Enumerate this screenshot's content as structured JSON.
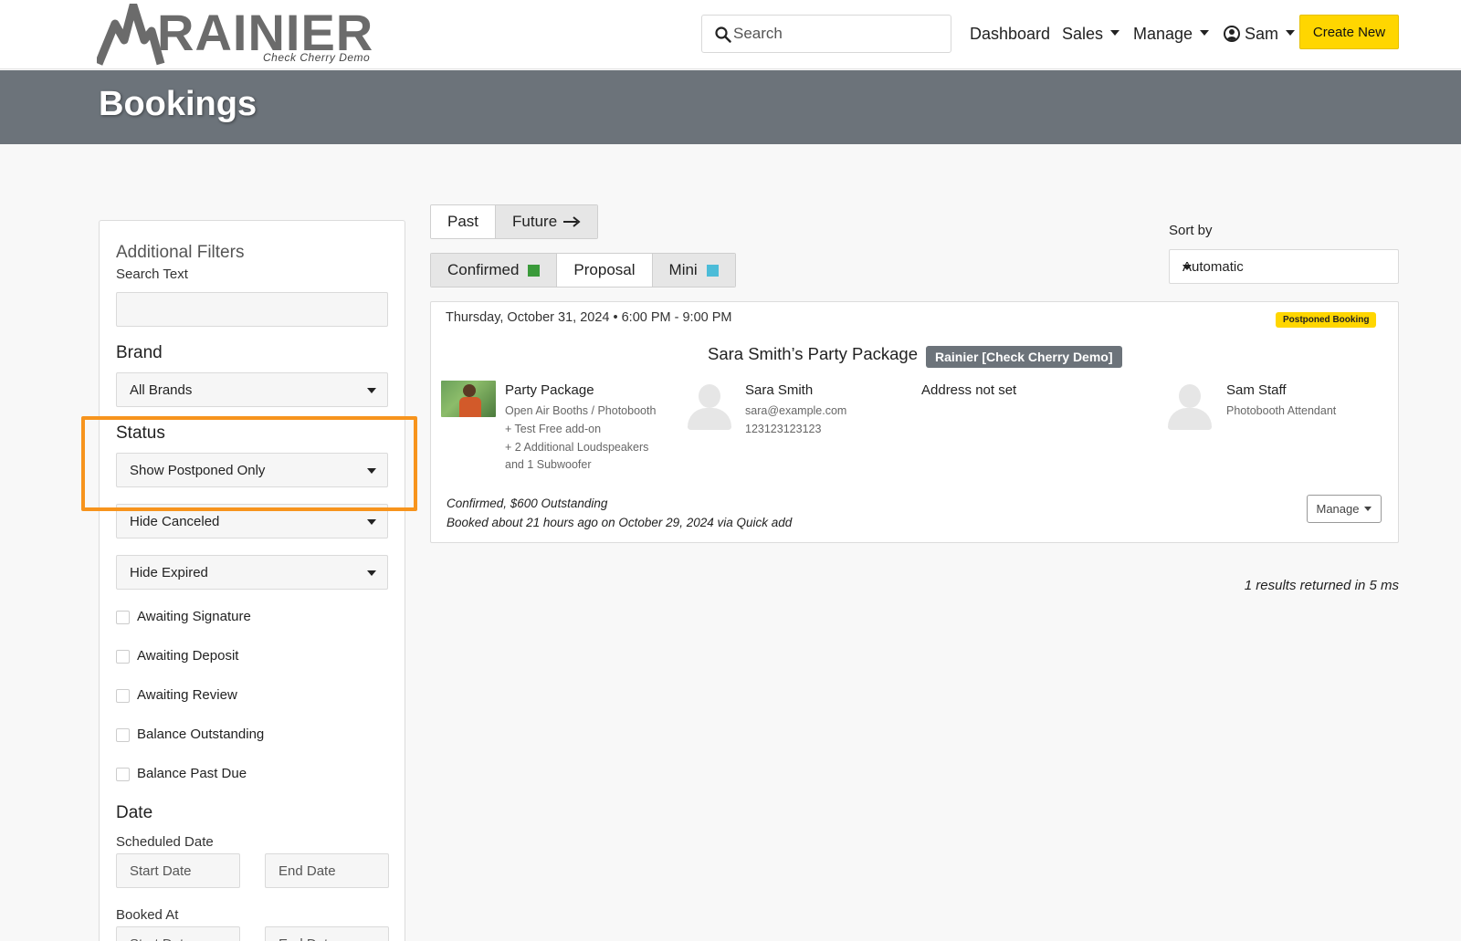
{
  "header": {
    "logo_text": "RAINIER",
    "logo_subtitle": "Check Cherry Demo",
    "search_placeholder": "Search",
    "nav": {
      "dashboard": "Dashboard",
      "sales": "Sales",
      "manage": "Manage",
      "user": "Sam"
    },
    "create_button": "Create New"
  },
  "page_title": "Bookings",
  "filters": {
    "title": "Additional Filters",
    "search_text_label": "Search Text",
    "search_text_value": "",
    "brand_label": "Brand",
    "brand_value": "All Brands",
    "status_label": "Status",
    "status_value": "Show Postponed Only",
    "canceled_value": "Hide Canceled",
    "expired_value": "Hide Expired",
    "checkboxes": [
      {
        "label": "Awaiting Signature",
        "checked": false
      },
      {
        "label": "Awaiting Deposit",
        "checked": false
      },
      {
        "label": "Awaiting Review",
        "checked": false
      },
      {
        "label": "Balance Outstanding",
        "checked": false
      },
      {
        "label": "Balance Past Due",
        "checked": false
      }
    ],
    "date_heading": "Date",
    "scheduled_label": "Scheduled Date",
    "booked_at_label": "Booked At",
    "start_placeholder": "Start Date",
    "end_placeholder": "End Date"
  },
  "time_tabs": {
    "past": "Past",
    "future": "Future",
    "active": "future"
  },
  "type_tabs": {
    "confirmed": "Confirmed",
    "proposal": "Proposal",
    "mini": "Mini",
    "confirmed_color": "#3a9a3a",
    "mini_color": "#4cbcd8"
  },
  "sort": {
    "label": "Sort by",
    "value": "Automatic"
  },
  "booking": {
    "datetime": "Thursday, October 31, 2024 • 6:00 PM - 9:00 PM",
    "status_badge": "Postponed Booking",
    "title": "Sara Smith’s Party Package",
    "brand": "Rainier [Check Cherry Demo]",
    "package": {
      "name": "Party Package",
      "line1": "Open Air Booths / Photobooth",
      "line2": "+ Test Free add-on",
      "line3": "+ 2 Additional Loudspeakers",
      "line4": "and 1 Subwoofer"
    },
    "client": {
      "name": "Sara Smith",
      "email": "sara@example.com",
      "phone": "123123123123"
    },
    "address": "Address not set",
    "staff": {
      "name": "Sam Staff",
      "role": "Photobooth Attendant"
    },
    "summary": "Confirmed, $600 Outstanding",
    "booked_info": "Booked about 21 hours ago on October 29, 2024 via Quick add",
    "manage_button": "Manage"
  },
  "results_text": "1 results returned in 5 ms",
  "colors": {
    "accent": "#ffd600",
    "banner": "#6c737a",
    "highlight": "#f7941d"
  }
}
